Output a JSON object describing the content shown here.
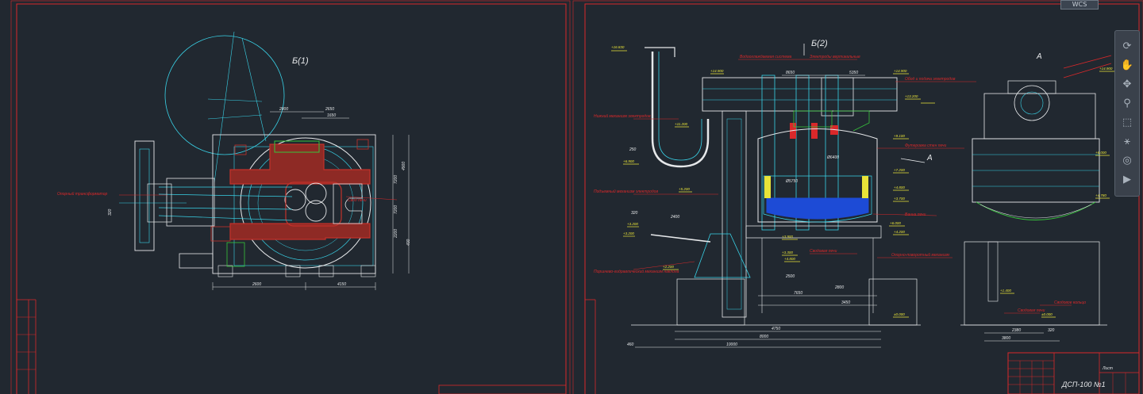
{
  "app": {
    "viewcube_label": "WCS"
  },
  "colors": {
    "background": "#212830",
    "frame": "#d9282a",
    "line_cyan": "#39d3e8",
    "line_white": "#e6e8ea",
    "hatch_red": "#c3322b",
    "yellow": "#e8e338",
    "green": "#37c43c",
    "blue": "#1d4bd6"
  },
  "left_view": {
    "title": "Б(1)",
    "callout_left": "Опорный трансформатор",
    "callout_right": "Свод печи",
    "dims": {
      "d1": "2800",
      "d2": "2650",
      "d3": "1650",
      "d4": "4900",
      "d5": "7200",
      "d6": "7200",
      "d7": "2200",
      "d8": "4150",
      "d9": "2600",
      "d10": "400",
      "d11": "320"
    }
  },
  "middle_view": {
    "title": "Б(2)",
    "arrow_label": "А",
    "labels": {
      "top_a": "Водоохлаждаемая система",
      "top_b": "Электроды вертикальные",
      "left_a": "Нижний механизм электродов",
      "left_b": "Подъемный механизм электродов",
      "left_c": "Поршнево-гидравлический механизм наклона",
      "right_a": "Обод и подача электродов",
      "right_b": "Футеровка стен печи",
      "right_c": "Ванна печи",
      "bottom_a": "Сводовая печи",
      "bottom_b": "Опорно-поворотный механизм"
    },
    "elevations": [
      "+16.830",
      "+14.900",
      "+14.900",
      "+13.200",
      "+11.200",
      "+9.100",
      "+7.200",
      "+6.900",
      "+5.200",
      "+4.800",
      "+3.700",
      "+3.200",
      "+3.200",
      "+2.200",
      "±0.000",
      "+6.000",
      "+4.200",
      "+3.900",
      "+3.300",
      "+4.800",
      "+6.800",
      "+8.000"
    ],
    "dims": {
      "w1": "8650",
      "w2": "5350",
      "w3": "2500",
      "w4": "2800",
      "w5": "7650",
      "w6": "3450",
      "w7": "4750",
      "w8": "8000",
      "w9": "10000",
      "w10": "460",
      "w11": "250",
      "w12": "2400",
      "w13": "320",
      "d_vessel": "Ø6400",
      "d_inner": "Ø5750"
    }
  },
  "right_view": {
    "title": "А",
    "labels": {
      "a": "Сводовое кольцо",
      "b": "Сводовая печи"
    },
    "elevations": [
      "+14.900",
      "+6.000",
      "+4.780",
      "+1.400",
      "±0.000"
    ],
    "dims": {
      "r1": "2380",
      "r2": "3800",
      "r3": "320"
    }
  },
  "title_block": {
    "name": "ДСП-100 №1",
    "sheet": "Лист"
  },
  "nav_icons": [
    "orbit-icon",
    "hand-icon",
    "pan-icon",
    "zoom-icon",
    "extents-icon",
    "walk-icon",
    "steering-icon",
    "showmotion-icon"
  ]
}
